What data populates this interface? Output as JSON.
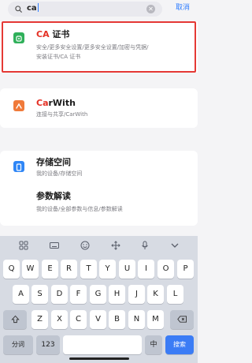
{
  "search": {
    "query": "ca",
    "cancel_label": "取消"
  },
  "results": [
    {
      "title_highlight": "CA",
      "title_rest": " 证书",
      "subtitle_line1": "安全/更多安全设置/更多安全设置/加密与凭据/",
      "subtitle_line2": "安装证书/CA 证书",
      "icon": "shield-icon",
      "icon_color": "#2fb05a"
    },
    {
      "title_highlight": "Ca",
      "title_rest": "rWith",
      "subtitle_line1": "连接与共享/CarWith",
      "icon": "carwith-icon",
      "icon_color": "#f07a3a"
    },
    {
      "title_highlight": "",
      "title_rest": "存储空间",
      "subtitle_line1": "我的设备/存储空间",
      "icon": "storage-icon",
      "icon_color": "#2f86f6"
    },
    {
      "title_highlight": "",
      "title_rest": "参数解读",
      "subtitle_line1": "我的设备/全部参数与信息/参数解读"
    }
  ],
  "keyboard": {
    "toolbar_icons": [
      "grid-icon",
      "keyboard-icon",
      "emoji-icon",
      "cursor-move-icon",
      "mic-icon",
      "collapse-icon"
    ],
    "row1": [
      "Q",
      "W",
      "E",
      "R",
      "T",
      "Y",
      "U",
      "I",
      "O",
      "P"
    ],
    "row2": [
      "A",
      "S",
      "D",
      "F",
      "G",
      "H",
      "J",
      "K",
      "L"
    ],
    "row3": [
      "Z",
      "X",
      "C",
      "V",
      "B",
      "N",
      "M"
    ],
    "fenci_label": "分词",
    "enter_label": "搜索",
    "accent_color": "#3b7cf5"
  }
}
